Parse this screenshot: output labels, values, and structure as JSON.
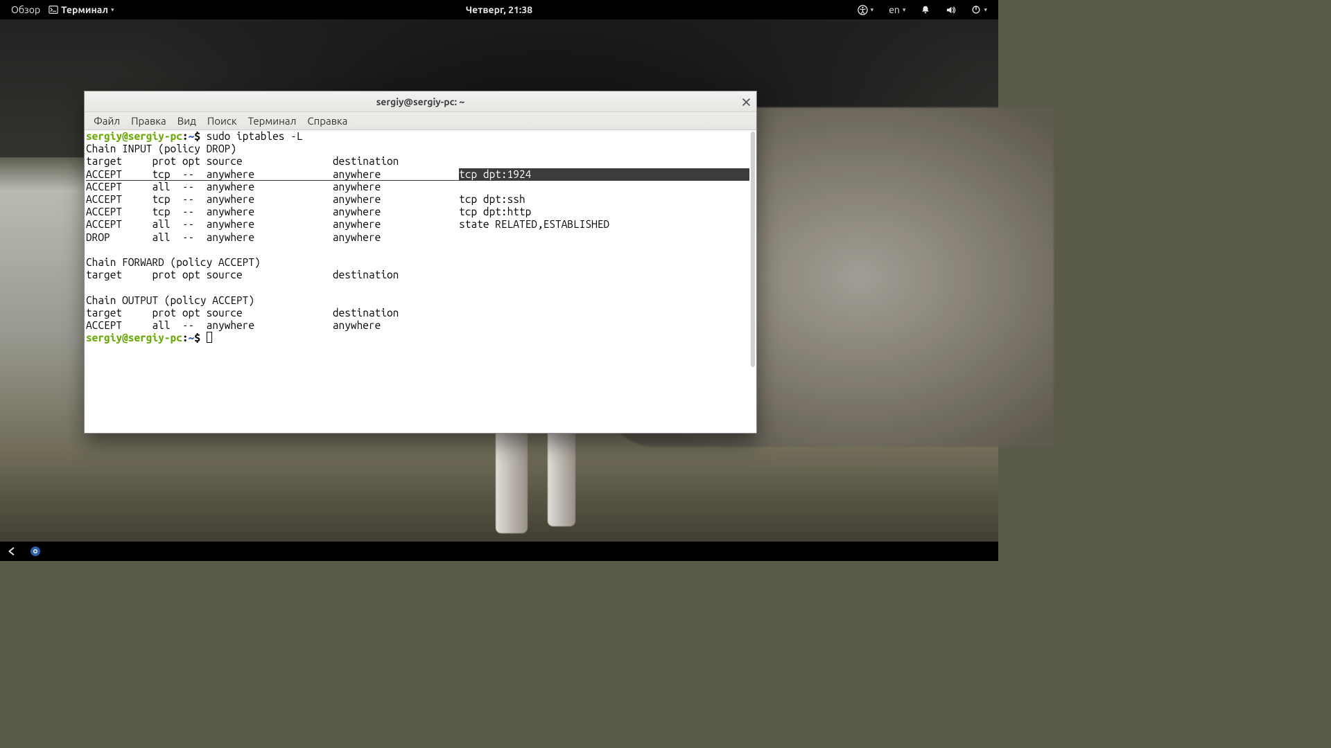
{
  "top_panel": {
    "activities": "Обзор",
    "app_indicator_label": "Терминал",
    "clock": "Четверг, 21:38",
    "keyboard_layout": "en"
  },
  "window": {
    "title": "sergiy@sergiy-pc: ~",
    "menus": [
      "Файл",
      "Правка",
      "Вид",
      "Поиск",
      "Терминал",
      "Справка"
    ]
  },
  "terminal": {
    "prompt_user_host": "sergiy@sergiy-pc",
    "prompt_cwd": "~",
    "prompt_sigil": "$",
    "command": "sudo iptables -L",
    "output": {
      "chain_input_header": "Chain INPUT (policy DROP)",
      "columns_header": "target     prot opt source               destination",
      "input_rules": [
        {
          "line_pre": "ACCEPT     tcp  --  anywhere             anywhere             ",
          "extra": "tcp dpt:1924",
          "highlight_extra": true
        },
        {
          "line_pre": "ACCEPT     all  --  anywhere             anywhere",
          "extra": "",
          "highlight_extra": false
        },
        {
          "line_pre": "ACCEPT     tcp  --  anywhere             anywhere             ",
          "extra": "tcp dpt:ssh",
          "highlight_extra": false
        },
        {
          "line_pre": "ACCEPT     tcp  --  anywhere             anywhere             ",
          "extra": "tcp dpt:http",
          "highlight_extra": false
        },
        {
          "line_pre": "ACCEPT     all  --  anywhere             anywhere             ",
          "extra": "state RELATED,ESTABLISHED",
          "highlight_extra": false
        },
        {
          "line_pre": "DROP       all  --  anywhere             anywhere",
          "extra": "",
          "highlight_extra": false
        }
      ],
      "chain_forward_header": "Chain FORWARD (policy ACCEPT)",
      "forward_columns": "target     prot opt source               destination",
      "chain_output_header": "Chain OUTPUT (policy ACCEPT)",
      "output_columns": "target     prot opt source               destination",
      "output_rules": [
        {
          "line_pre": "ACCEPT     all  --  anywhere             anywhere",
          "extra": "",
          "highlight_extra": false
        }
      ]
    }
  }
}
